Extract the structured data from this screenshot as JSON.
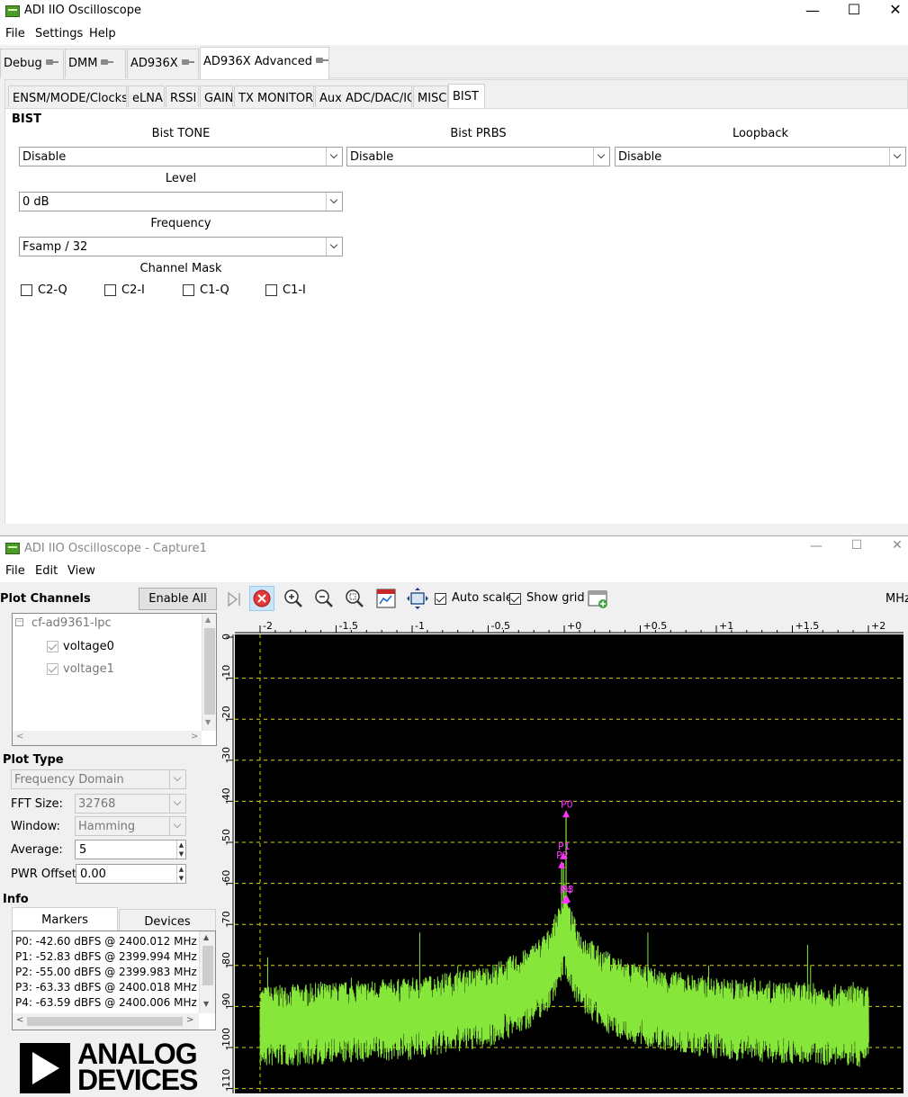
{
  "main_window": {
    "title": "ADI IIO Oscilloscope",
    "menu": [
      "File",
      "Settings",
      "Help"
    ],
    "device_tabs": [
      "Debug",
      "DMM",
      "AD936X",
      "AD936X Advanced"
    ],
    "sub_tabs": [
      "ENSM/MODE/Clocks",
      "eLNA",
      "RSSI",
      "GAIN",
      "TX MONITOR",
      "Aux ADC/DAC/IO",
      "MISC",
      "BIST"
    ],
    "bist": {
      "section_title": "BIST",
      "tone_label": "Bist TONE",
      "tone_value": "Disable",
      "prbs_label": "Bist PRBS",
      "prbs_value": "Disable",
      "loopback_label": "Loopback",
      "loopback_value": "Disable",
      "level_label": "Level",
      "level_value": "0 dB",
      "frequency_label": "Frequency",
      "frequency_value": "Fsamp / 32",
      "channel_mask_label": "Channel Mask",
      "channels": [
        "C2-Q",
        "C2-I",
        "C1-Q",
        "C1-I"
      ]
    }
  },
  "capture_window": {
    "title": "ADI IIO Oscilloscope - Capture1",
    "menu": [
      "File",
      "Edit",
      "View"
    ],
    "plot_channels_title": "Plot Channels",
    "enable_all_label": "Enable All",
    "device_name": "cf-ad9361-lpc",
    "channels": [
      "voltage0",
      "voltage1"
    ],
    "plot_type_title": "Plot Type",
    "plot_type_value": "Frequency Domain",
    "fft_size_label": "FFT Size:",
    "fft_size_value": "32768",
    "window_label": "Window:",
    "window_value": "Hamming",
    "average_label": "Average:",
    "average_value": "5",
    "pwr_offset_label": "PWR Offset:",
    "pwr_offset_value": "0.00",
    "info_title": "Info",
    "info_tabs": [
      "Markers",
      "Devices"
    ],
    "markers": [
      "P0: -42.60 dBFS @ 2400.012 MHz",
      "P1: -52.83 dBFS @ 2399.994 MHz",
      "P2: -55.00 dBFS @ 2399.983 MHz",
      "P3: -63.33 dBFS @ 2400.018 MHz",
      "P4: -63.59 dBFS @ 2400.006 MHz"
    ],
    "auto_scale_label": "Auto scale",
    "show_grid_label": "Show grid",
    "unit_label": "MHz",
    "logo_line1": "ANALOG",
    "logo_line2": "DEVICES"
  },
  "chart_data": {
    "type": "line",
    "x_unit": "MHz",
    "x_ticks": [
      "-2",
      "-1.5",
      "-1",
      "-0.5",
      "+0",
      "+0.5",
      "+1",
      "+1.5",
      "+2"
    ],
    "y_ticks": [
      "0",
      "-10",
      "-20",
      "-30",
      "-40",
      "-50",
      "-60",
      "-70",
      "-80",
      "-90",
      "-100",
      "-110"
    ],
    "xlim": [
      -2,
      2
    ],
    "ylim": [
      -110,
      0
    ],
    "grid": true,
    "series_color": "#86e63a",
    "marker_color": "#ff33ff",
    "noise_floor_dbfs": -95,
    "spectrum_shape": [
      {
        "x": -2.0,
        "y": -93
      },
      {
        "x": -1.5,
        "y": -92
      },
      {
        "x": -1.0,
        "y": -91
      },
      {
        "x": -0.5,
        "y": -88
      },
      {
        "x": -0.25,
        "y": -84
      },
      {
        "x": -0.1,
        "y": -79
      },
      {
        "x": -0.03,
        "y": -73
      },
      {
        "x": 0.0,
        "y": -70
      },
      {
        "x": 0.03,
        "y": -73
      },
      {
        "x": 0.1,
        "y": -79
      },
      {
        "x": 0.25,
        "y": -84
      },
      {
        "x": 0.5,
        "y": -88
      },
      {
        "x": 1.0,
        "y": -91
      },
      {
        "x": 1.5,
        "y": -92
      },
      {
        "x": 2.0,
        "y": -93
      }
    ],
    "markers": [
      {
        "name": "P0",
        "x": 0.012,
        "y": -42.6
      },
      {
        "name": "P1",
        "x": -0.006,
        "y": -52.83
      },
      {
        "name": "P2",
        "x": -0.017,
        "y": -55.0
      },
      {
        "name": "P3",
        "x": 0.018,
        "y": -63.33
      },
      {
        "name": "P4",
        "x": 0.006,
        "y": -63.59
      }
    ]
  },
  "colors": {
    "plot_bg": "#000000",
    "grid": "#d8d800",
    "series": "#86e63a",
    "marker": "#ff33ff",
    "stop_button": "#e53935"
  }
}
